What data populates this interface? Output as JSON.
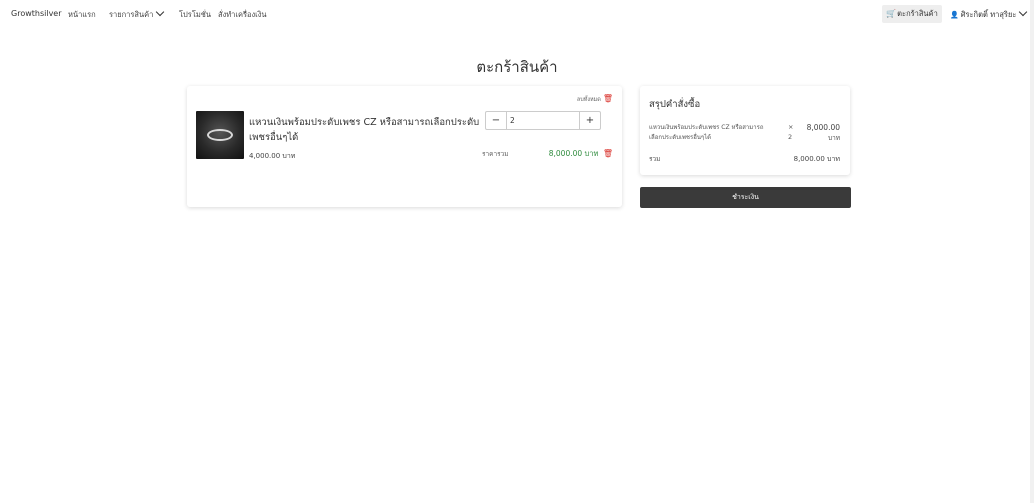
{
  "nav": {
    "brand": "Growthsilver",
    "home": "หน้าแรก",
    "products": "รายการสินค้า",
    "promotions": "โปรโมชั่น",
    "custom_order": "สั่งทำเครื่องเงิน",
    "cart": "ตะกร้าสินค้า",
    "user": "ศิระกิตติ์ ทาสุริยะ"
  },
  "page": {
    "title": "ตะกร้าสินค้า"
  },
  "cart": {
    "remove_all": "ลบทั้งหมด",
    "items": [
      {
        "name": "แหวนเงินพร้อมประดับเพชร CZ หรือสามารถเลือกประดับเพชรอื่นๆได้",
        "unit_price": "4,000.00 บาท",
        "quantity": "2",
        "total_label": "ราคารวม",
        "total_value": "8,000.00 บาท"
      }
    ]
  },
  "summary": {
    "title": "สรุปคำสั่งซื้อ",
    "item_name": "แหวนเงินพร้อมประดับเพชร CZ หรือสามารถเลือกประดับเพชรอื่นๆได้",
    "times": "×",
    "qty": "2",
    "price": "8,000.00",
    "unit": "บาท",
    "total_label": "รวม",
    "total_value": "8,000.00 บาท"
  },
  "pay_button": "ชำระเงิน",
  "icons": {
    "cart": "cart-icon",
    "user": "user-icon",
    "trash": "trash-icon",
    "chevron": "chevron-down-icon"
  },
  "colors": {
    "accent_green": "#2e8b3d",
    "danger_red": "#d9302a",
    "button_dark": "#3a3a3a"
  }
}
